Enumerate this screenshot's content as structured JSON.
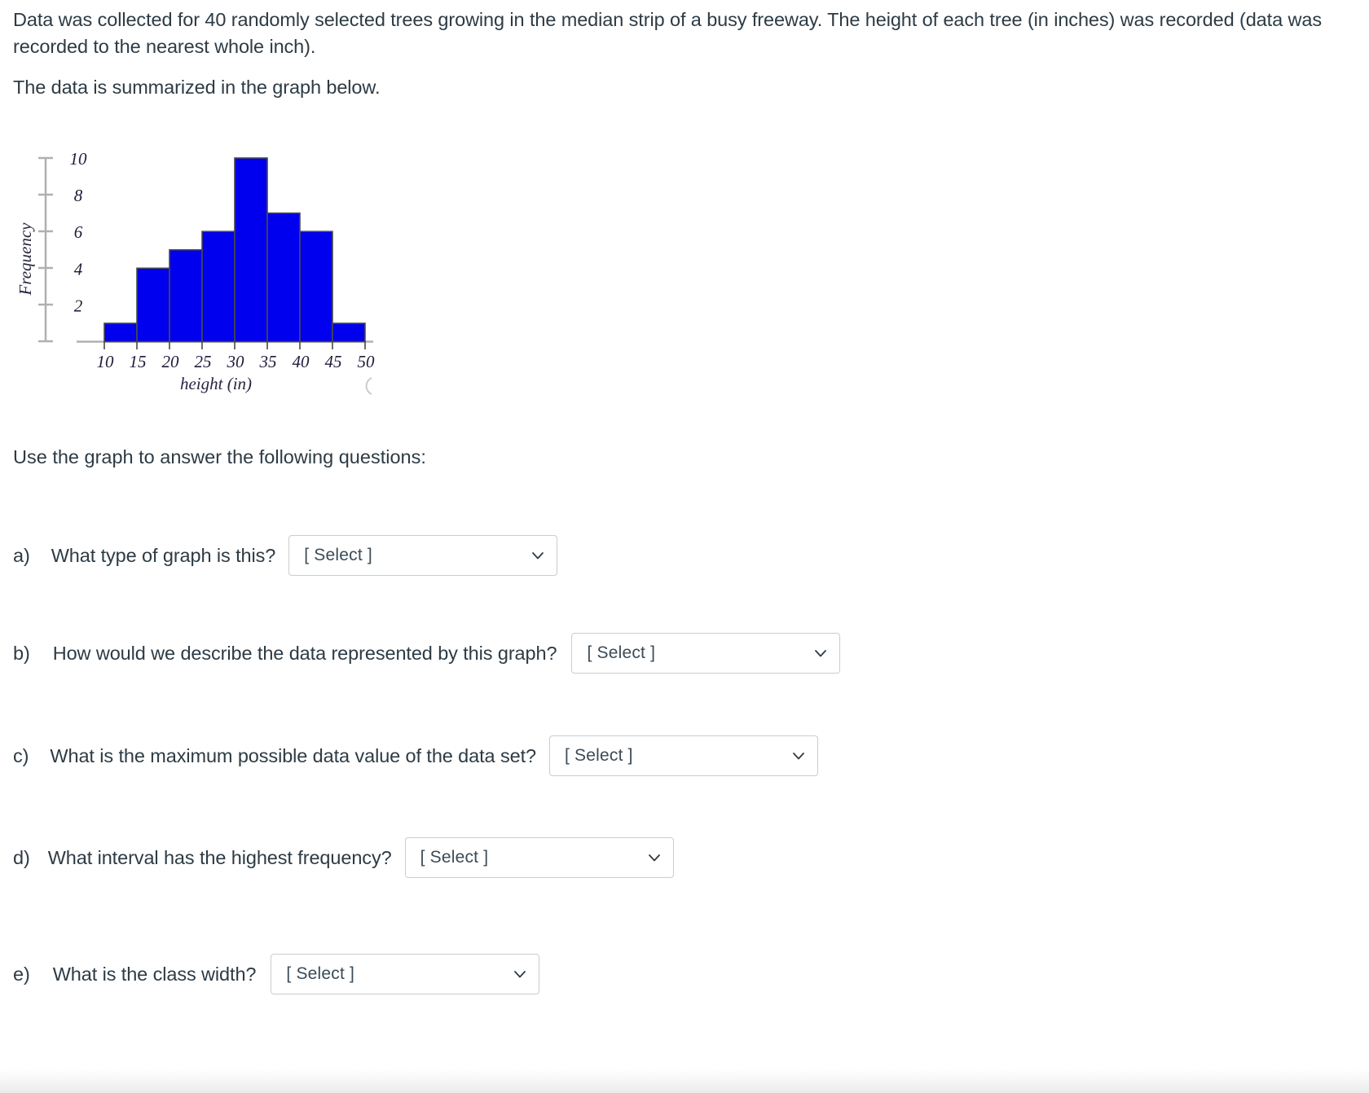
{
  "intro": {
    "paragraph1": "Data was collected for 40 randomly selected trees growing in the median strip of a busy freeway.   The height of each tree (in inches) was recorded (data was recorded to the nearest whole inch).",
    "paragraph2": "The data is summarized in the graph below."
  },
  "section_prompt": "Use the graph to answer the following questions:",
  "chart_data": {
    "type": "bar",
    "title": "",
    "xlabel": "height (in)",
    "ylabel": "Frequency",
    "bin_edges": [
      10,
      15,
      20,
      25,
      30,
      35,
      40,
      45,
      50
    ],
    "categories": [
      "10-15",
      "15-20",
      "20-25",
      "25-30",
      "30-35",
      "35-40",
      "40-45",
      "45-50"
    ],
    "values": [
      1,
      4,
      5,
      6,
      10,
      7,
      6,
      1
    ],
    "x_tick_labels": [
      "10",
      "15",
      "20",
      "25",
      "30",
      "35",
      "40",
      "45",
      "50"
    ],
    "y_tick_labels": [
      "2",
      "4",
      "6",
      "8",
      "10"
    ],
    "y_ticks": [
      0,
      2,
      4,
      6,
      8,
      10
    ],
    "ylim": [
      0,
      11
    ],
    "xlim": [
      10,
      50
    ],
    "class_width": 5,
    "total_count": 40,
    "grid": false,
    "legend": false,
    "bar_color": "#0000EE",
    "bar_edge_color": "#4a4a4a",
    "axis_color": "#a8a8a8"
  },
  "questions": [
    {
      "id": "a",
      "marker": "a)",
      "text": "What type of graph is this?",
      "select_value": "[ Select ]"
    },
    {
      "id": "b",
      "marker": "b)",
      "text": "How would we describe the data represented by this graph?",
      "select_value": "[ Select ]"
    },
    {
      "id": "c",
      "marker": "c)",
      "text": "What is the maximum possible data value of the data set?",
      "select_value": "[ Select ]"
    },
    {
      "id": "d",
      "marker": "d)",
      "text": "What interval has the highest frequency?",
      "select_value": "[ Select ]"
    },
    {
      "id": "e",
      "marker": "e)",
      "text": "What is the class width?",
      "select_value": "[ Select ]"
    }
  ],
  "icons": {
    "dropdown": "chevron-down-icon"
  },
  "colors": {
    "text": "#2d3b45",
    "border": "#c7cdd1",
    "bar_blue": "#0000EE"
  }
}
